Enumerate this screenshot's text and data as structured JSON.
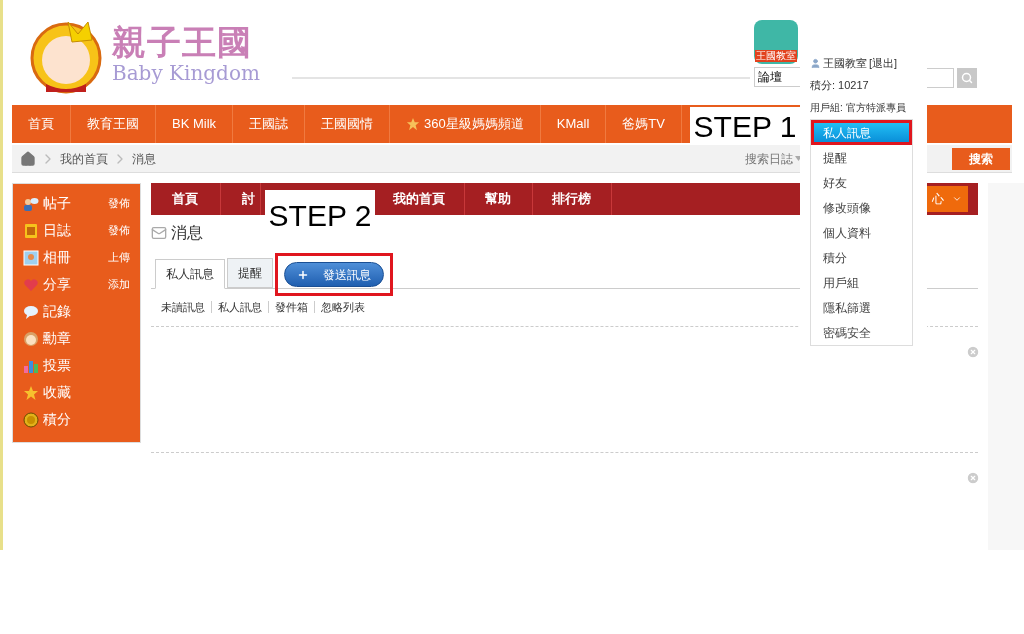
{
  "header": {
    "logo_title": "親子王國",
    "logo_subtitle": "Baby Kingdom",
    "app_badge": "王國教室",
    "forum_select": "論壇"
  },
  "main_nav": [
    {
      "label": "首頁",
      "kind": "plain"
    },
    {
      "label": "教育王國",
      "kind": "plain"
    },
    {
      "label": "BK Milk",
      "kind": "plain"
    },
    {
      "label": "王國誌",
      "kind": "plain"
    },
    {
      "label": "王國國情",
      "kind": "plain"
    },
    {
      "label": "360星級媽媽頻道",
      "kind": "starred"
    },
    {
      "label": "KMall",
      "kind": "plain"
    },
    {
      "label": "爸媽TV",
      "kind": "plain"
    }
  ],
  "breadcrumb": [
    "我的首頁",
    "消息"
  ],
  "search": {
    "scope": "搜索日誌",
    "button": "搜索"
  },
  "sidebar": [
    {
      "label": "帖子",
      "action": "發佈",
      "kind": "chat"
    },
    {
      "label": "日誌",
      "action": "發佈",
      "kind": "notebook"
    },
    {
      "label": "相冊",
      "action": "上傳",
      "kind": "photo"
    },
    {
      "label": "分享",
      "action": "添加",
      "kind": "heart"
    },
    {
      "label": "記錄",
      "kind": "bubble"
    },
    {
      "label": "勳章",
      "kind": "medal"
    },
    {
      "label": "投票",
      "kind": "bars"
    },
    {
      "label": "收藏",
      "kind": "star"
    },
    {
      "label": "積分",
      "kind": "coin"
    }
  ],
  "sub_nav": {
    "items": [
      "首頁",
      "討",
      "我的首頁",
      "幫助",
      "排行榜"
    ],
    "menu_button": "心"
  },
  "page_title": "消息",
  "tabs": [
    {
      "label": "私人訊息",
      "selected": true
    },
    {
      "label": "提醒",
      "selected": false
    }
  ],
  "compose_button": {
    "label": "發送訊息",
    "highlighted": true
  },
  "filters": [
    "未讀訊息",
    "私人訊息",
    "發件箱",
    "忽略列表"
  ],
  "messages": [
    {
      "dismissible": true
    },
    {
      "dismissible": true
    }
  ],
  "user_menu": {
    "username": "王國教室",
    "logout": "[退出]",
    "points": "積分: 10217",
    "group": "用戶組: 官方特派專員",
    "items": [
      {
        "label": "私人訊息",
        "selected": true,
        "highlighted": true
      },
      {
        "label": "提醒",
        "selected": false,
        "highlighted": false
      },
      {
        "label": "好友",
        "selected": false,
        "highlighted": false
      },
      {
        "label": "修改頭像",
        "selected": false,
        "highlighted": false
      },
      {
        "label": "個人資料",
        "selected": false,
        "highlighted": false
      },
      {
        "label": "積分",
        "selected": false,
        "highlighted": false
      },
      {
        "label": "用戶組",
        "selected": false,
        "highlighted": false
      },
      {
        "label": "隱私篩選",
        "selected": false,
        "highlighted": false
      },
      {
        "label": "密碼安全",
        "selected": false,
        "highlighted": false
      }
    ]
  },
  "annotations": [
    {
      "kind": "step",
      "text": "STEP 1"
    },
    {
      "kind": "step",
      "text": "STEP 2"
    }
  ]
}
